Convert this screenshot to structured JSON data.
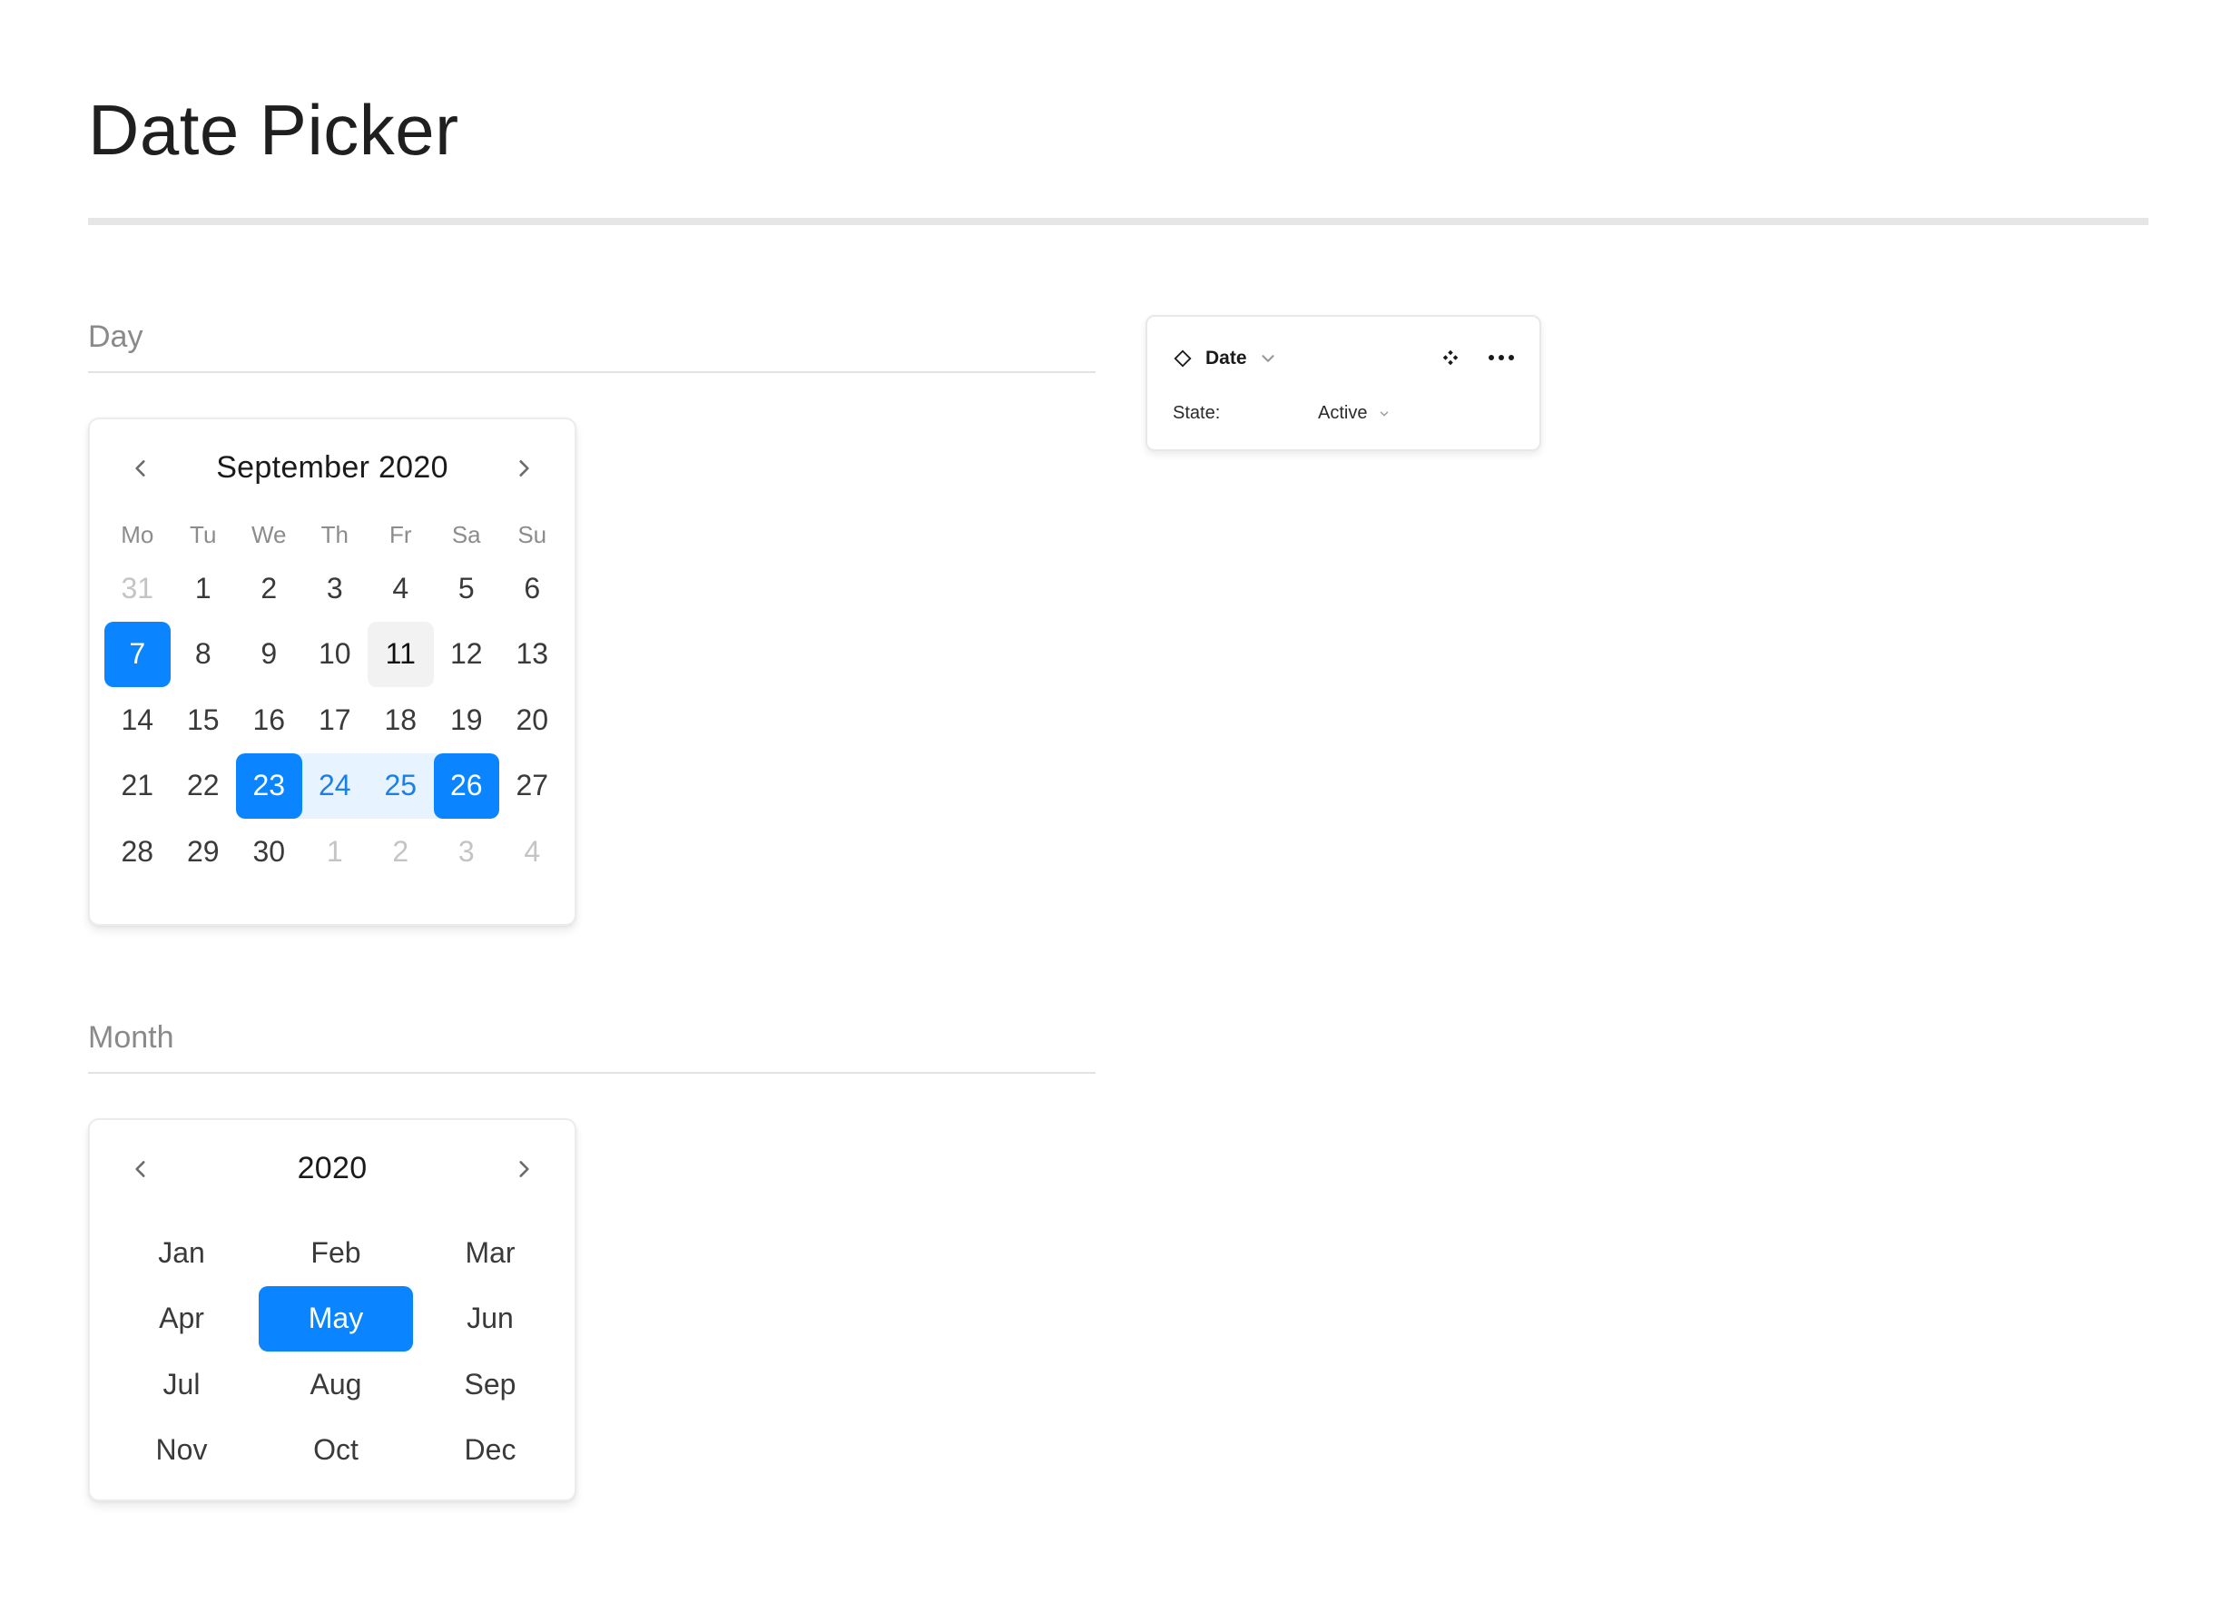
{
  "page": {
    "title": "Date Picker"
  },
  "day_section": {
    "label": "Day",
    "picker": {
      "title": "September 2020",
      "weekdays": [
        "Mo",
        "Tu",
        "We",
        "Th",
        "Fr",
        "Sa",
        "Su"
      ],
      "days": [
        {
          "label": "31",
          "state": "muted"
        },
        {
          "label": "1",
          "state": "normal"
        },
        {
          "label": "2",
          "state": "normal"
        },
        {
          "label": "3",
          "state": "normal"
        },
        {
          "label": "4",
          "state": "normal"
        },
        {
          "label": "5",
          "state": "normal"
        },
        {
          "label": "6",
          "state": "normal"
        },
        {
          "label": "7",
          "state": "selected"
        },
        {
          "label": "8",
          "state": "normal"
        },
        {
          "label": "9",
          "state": "normal"
        },
        {
          "label": "10",
          "state": "normal"
        },
        {
          "label": "11",
          "state": "today"
        },
        {
          "label": "12",
          "state": "normal"
        },
        {
          "label": "13",
          "state": "normal"
        },
        {
          "label": "14",
          "state": "normal"
        },
        {
          "label": "15",
          "state": "normal"
        },
        {
          "label": "16",
          "state": "normal"
        },
        {
          "label": "17",
          "state": "normal"
        },
        {
          "label": "18",
          "state": "normal"
        },
        {
          "label": "19",
          "state": "normal"
        },
        {
          "label": "20",
          "state": "normal"
        },
        {
          "label": "21",
          "state": "normal"
        },
        {
          "label": "22",
          "state": "normal"
        },
        {
          "label": "23",
          "state": "range-start"
        },
        {
          "label": "24",
          "state": "in-range"
        },
        {
          "label": "25",
          "state": "in-range"
        },
        {
          "label": "26",
          "state": "range-end"
        },
        {
          "label": "27",
          "state": "normal"
        },
        {
          "label": "28",
          "state": "normal"
        },
        {
          "label": "29",
          "state": "normal"
        },
        {
          "label": "30",
          "state": "normal"
        },
        {
          "label": "1",
          "state": "muted"
        },
        {
          "label": "2",
          "state": "muted"
        },
        {
          "label": "3",
          "state": "muted"
        },
        {
          "label": "4",
          "state": "muted"
        }
      ]
    }
  },
  "month_section": {
    "label": "Month",
    "picker": {
      "title": "2020",
      "months": [
        {
          "label": "Jan",
          "state": "normal"
        },
        {
          "label": "Feb",
          "state": "normal"
        },
        {
          "label": "Mar",
          "state": "normal"
        },
        {
          "label": "Apr",
          "state": "normal"
        },
        {
          "label": "May",
          "state": "selected"
        },
        {
          "label": "Jun",
          "state": "normal"
        },
        {
          "label": "Jul",
          "state": "normal"
        },
        {
          "label": "Aug",
          "state": "normal"
        },
        {
          "label": "Sep",
          "state": "normal"
        },
        {
          "label": "Nov",
          "state": "normal"
        },
        {
          "label": "Oct",
          "state": "normal"
        },
        {
          "label": "Dec",
          "state": "normal"
        }
      ]
    }
  },
  "property_panel": {
    "component_name": "Date",
    "state_label": "State:",
    "state_value": "Active",
    "icons": [
      "component-diamond-icon",
      "chevron-down-icon",
      "component-set-icon",
      "more-icon"
    ]
  },
  "colors": {
    "accent": "#0a84ff",
    "range_bg": "#e7f3ff",
    "range_text": "#1a80e6",
    "muted_text": "#c4c4c4",
    "today_bg": "#f2f2f2"
  }
}
